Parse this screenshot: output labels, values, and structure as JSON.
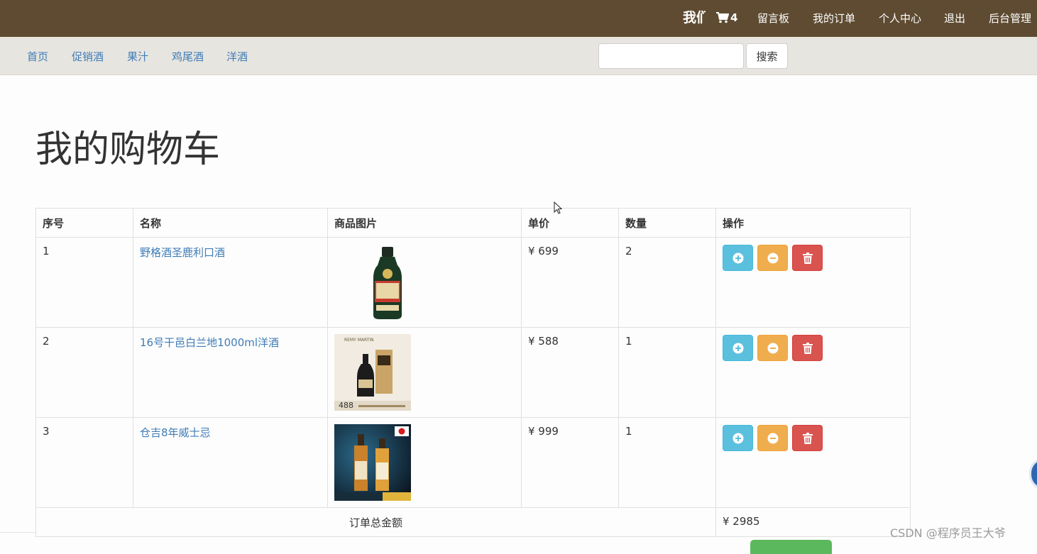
{
  "topbar": {
    "brand": "我们",
    "cart_count": "4",
    "links": [
      "留言板",
      "我的订单",
      "个人中心",
      "退出",
      "后台管理"
    ]
  },
  "nav": {
    "categories": [
      "首页",
      "促销酒",
      "果汁",
      "鸡尾酒",
      "洋酒"
    ],
    "search_placeholder": "",
    "search_button": "搜索"
  },
  "page": {
    "title": "我的购物车"
  },
  "table": {
    "headers": [
      "序号",
      "名称",
      "商品图片",
      "单价",
      "数量",
      "操作"
    ],
    "rows": [
      {
        "index": "1",
        "name": "野格酒圣鹿利口酒",
        "price": "¥ 699",
        "qty": "2"
      },
      {
        "index": "2",
        "name": "16号干邑白兰地1000ml洋酒",
        "price": "¥ 588",
        "qty": "1"
      },
      {
        "index": "3",
        "name": "仓吉8年威士忌",
        "price": "¥ 999",
        "qty": "1"
      }
    ],
    "total_label": "订单总金额",
    "total_value": "¥ 2985"
  },
  "images": {
    "row2_tag": "488",
    "row2_brand": "REMY MARTIN"
  },
  "watermark": "CSDN @程序员王大爷",
  "colors": {
    "topbar": "#5e4b31",
    "nav": "#e7e5e0",
    "link": "#3f7cb6",
    "add": "#5bc0de",
    "sub": "#f0ad4e",
    "del": "#d9534f",
    "checkout": "#5cb85c"
  }
}
